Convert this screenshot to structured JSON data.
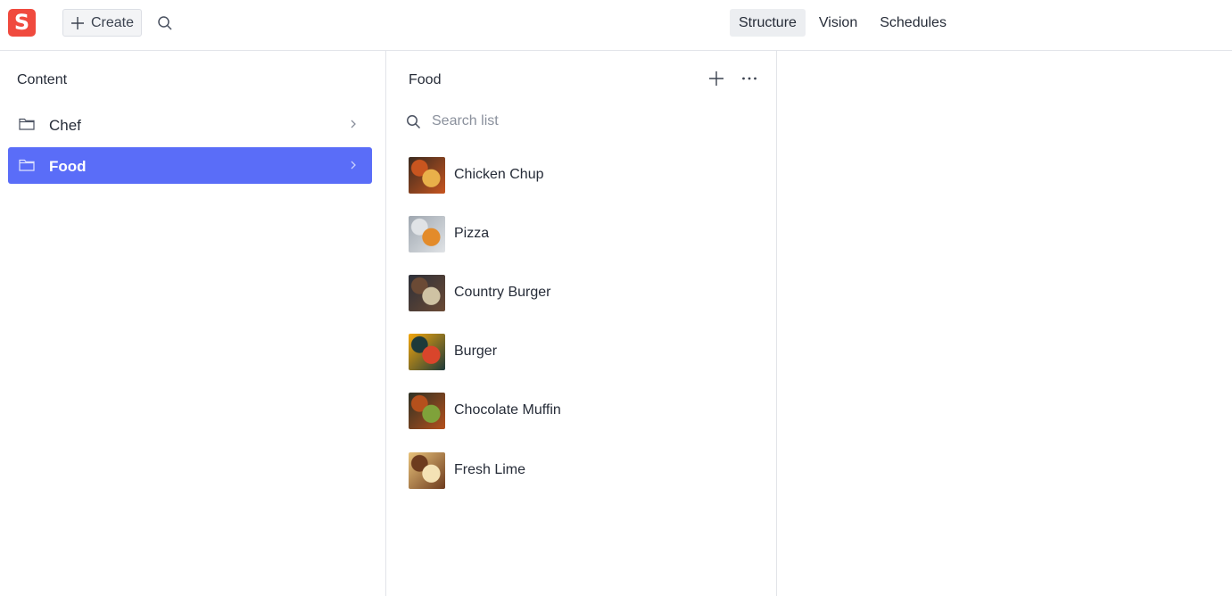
{
  "header": {
    "logo_letter": "S",
    "create_label": "Create",
    "tools": [
      {
        "label": "Structure",
        "active": true
      },
      {
        "label": "Vision",
        "active": false
      },
      {
        "label": "Schedules",
        "active": false
      }
    ]
  },
  "content_pane": {
    "title": "Content",
    "items": [
      {
        "label": "Chef",
        "selected": false
      },
      {
        "label": "Food",
        "selected": true
      }
    ]
  },
  "food_pane": {
    "title": "Food",
    "search_placeholder": "Search list",
    "items": [
      {
        "label": "Chicken Chup",
        "thumb_colors": [
          "#3a2a1f",
          "#c8551f",
          "#e9b04a"
        ]
      },
      {
        "label": "Pizza",
        "thumb_colors": [
          "#9fa7b0",
          "#e0e3e6",
          "#e38b2a"
        ]
      },
      {
        "label": "Country Burger",
        "thumb_colors": [
          "#2c2f38",
          "#6b4a35",
          "#cfc2a3"
        ]
      },
      {
        "label": "Burger",
        "thumb_colors": [
          "#f2a60c",
          "#1e3a3a",
          "#d9452b"
        ]
      },
      {
        "label": "Chocolate Muffin",
        "thumb_colors": [
          "#2e3124",
          "#b5501c",
          "#7fa23a"
        ]
      },
      {
        "label": "Fresh Lime",
        "thumb_colors": [
          "#e8c27a",
          "#6d3b1e",
          "#f4e2b5"
        ]
      }
    ]
  },
  "colors": {
    "accent": "#5a6df8",
    "logo": "#f04a3e"
  }
}
